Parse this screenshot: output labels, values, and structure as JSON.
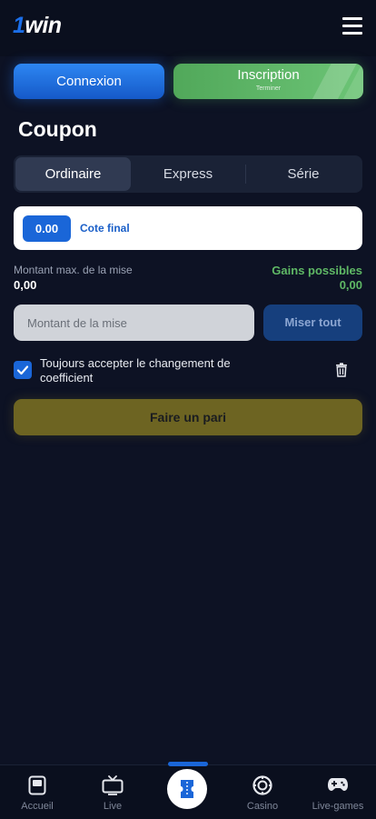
{
  "header": {
    "logo_text_one": "1",
    "logo_text_win": "win",
    "menu_icon": "hamburger-icon"
  },
  "auth": {
    "login_label": "Connexion",
    "signup_label": "Inscription",
    "signup_sub": "Terminer"
  },
  "coupon": {
    "title": "Coupon",
    "tabs": [
      {
        "label": "Ordinaire",
        "active": true
      },
      {
        "label": "Express",
        "active": false
      },
      {
        "label": "Série",
        "active": false
      }
    ],
    "cote_value": "0.00",
    "cote_label": "Cote final",
    "max_label": "Montant max. de la mise",
    "max_value": "0,00",
    "gains_label": "Gains possibles",
    "gains_value": "0,00",
    "stake_placeholder": "Montant de la mise",
    "max_button": "Miser tout",
    "accept_label": "Toujours accepter le changement de coefficient",
    "accept_checked": true,
    "bet_button": "Faire un pari"
  },
  "bottom_nav": {
    "items": [
      {
        "label": "Accueil",
        "icon": "home-icon"
      },
      {
        "label": "Live",
        "icon": "tv-icon"
      },
      {
        "label": "",
        "icon": "ticket-icon"
      },
      {
        "label": "Casino",
        "icon": "chip-icon"
      },
      {
        "label": "Live-games",
        "icon": "gamepad-icon"
      }
    ]
  },
  "colors": {
    "background": "#0d1224",
    "accent_blue": "#1a66d8",
    "accent_green": "#5fb865",
    "bet_button": "#6d6422"
  }
}
